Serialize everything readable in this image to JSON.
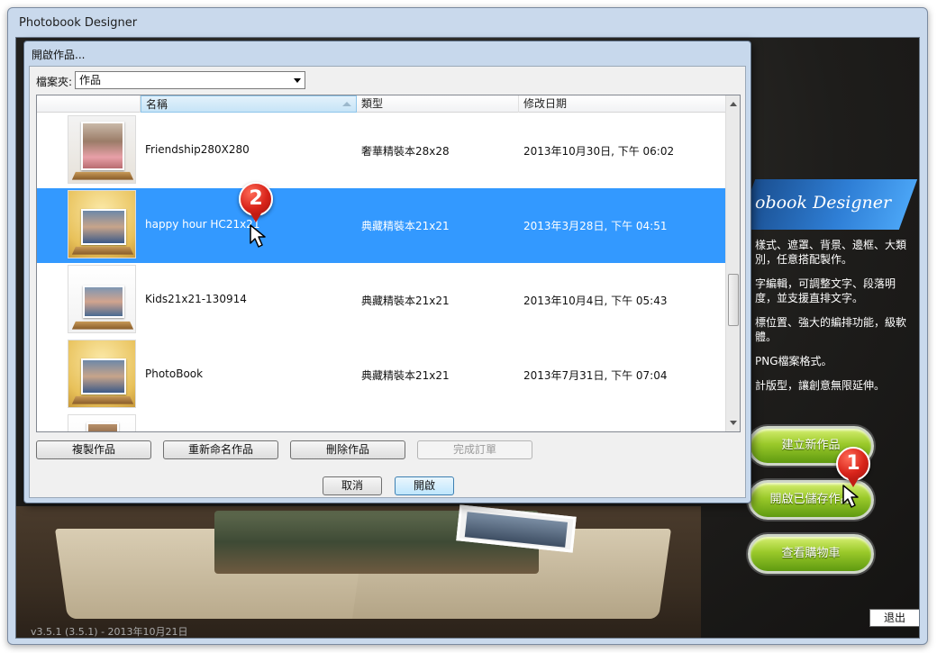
{
  "app": {
    "title": "Photobook Designer",
    "version": "v3.5.1 (3.5.1) - 2013年10月21日",
    "banner_text": "obook Designer",
    "features": [
      "樣式、遮罩、背景、邊框、大類別，任意搭配製作。",
      "字編輯，可調整文字、段落明度，並支援直排文字。",
      "標位置、強大的編排功能，級軟體。",
      "PNG檔案格式。",
      "計版型，讓創意無限延伸。"
    ],
    "buttons": {
      "new_project": "建立新作品",
      "open_saved": "開啟已儲存作品",
      "view_cart": "查看購物車",
      "exit": "退出"
    },
    "badges": {
      "step1": "1",
      "step2": "2"
    }
  },
  "dialog": {
    "title": "開啟作品...",
    "folder_label": "檔案夾:",
    "folder_value": "作品",
    "columns": {
      "name": "名稱",
      "type": "類型",
      "modified": "修改日期"
    },
    "rows": [
      {
        "name": "Friendship280X280",
        "type": "奢華精裝本28x28",
        "modified": "2013年10月30日, 下午 06:02",
        "selected": false
      },
      {
        "name": "happy hour HC21x21",
        "type": "典藏精裝本21x21",
        "modified": "2013年3月28日, 下午 04:51",
        "selected": true
      },
      {
        "name": "Kids21x21-130914",
        "type": "典藏精裝本21x21",
        "modified": "2013年10月4日, 下午 05:43",
        "selected": false
      },
      {
        "name": "PhotoBook",
        "type": "典藏精裝本21x21",
        "modified": "2013年7月31日, 下午 07:04",
        "selected": false
      }
    ],
    "actions": {
      "copy": "複製作品",
      "rename": "重新命名作品",
      "delete": "刪除作品",
      "finish_order": "完成訂單"
    },
    "footer": {
      "cancel": "取消",
      "open": "開啟"
    }
  },
  "colors": {
    "selection": "#3399ff",
    "green_button": "#8fc21f",
    "badge_red": "#d8241a",
    "banner_blue": "#2f7fd6"
  }
}
